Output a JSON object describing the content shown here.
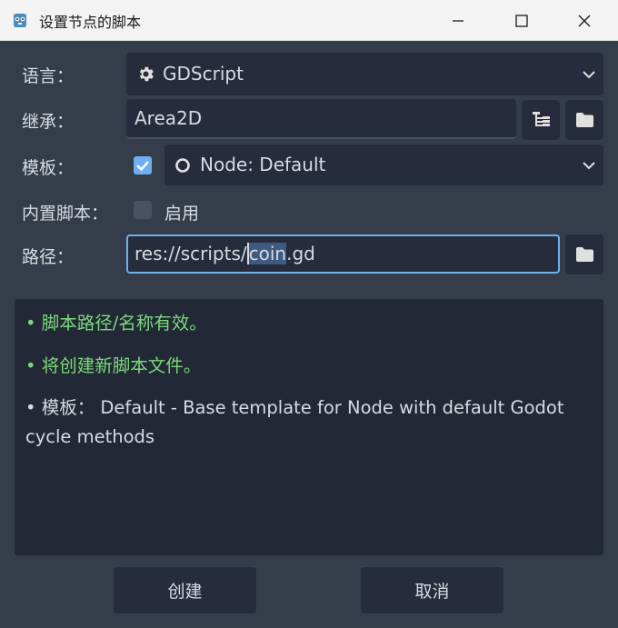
{
  "window": {
    "title": "设置节点的脚本"
  },
  "form": {
    "language": {
      "label": "语言：",
      "value": "GDScript",
      "icon": "gear-icon"
    },
    "inherits": {
      "label": "继承：",
      "value": "Area2D"
    },
    "template": {
      "label": "模板：",
      "checked": true,
      "value": "Node: Default"
    },
    "builtin": {
      "label": "内置脚本：",
      "checked": false,
      "toggle_label": "启用"
    },
    "path": {
      "label": "路径：",
      "prefix": "res://scripts/",
      "selected": "coin",
      "suffix": ".gd"
    }
  },
  "messages": [
    {
      "text": "•  脚本路径/名称有效。",
      "color": "#7ad97a"
    },
    {
      "text": "•  将创建新脚本文件。",
      "color": "#7ad97a"
    },
    {
      "text": "•  模板： Default - Base template for Node with default Godot cycle methods",
      "color": "#d6dbe2"
    }
  ],
  "buttons": {
    "create": "创建",
    "cancel": "取消"
  },
  "colors": {
    "accent": "#6fb0f0",
    "valid": "#7ad97a"
  }
}
